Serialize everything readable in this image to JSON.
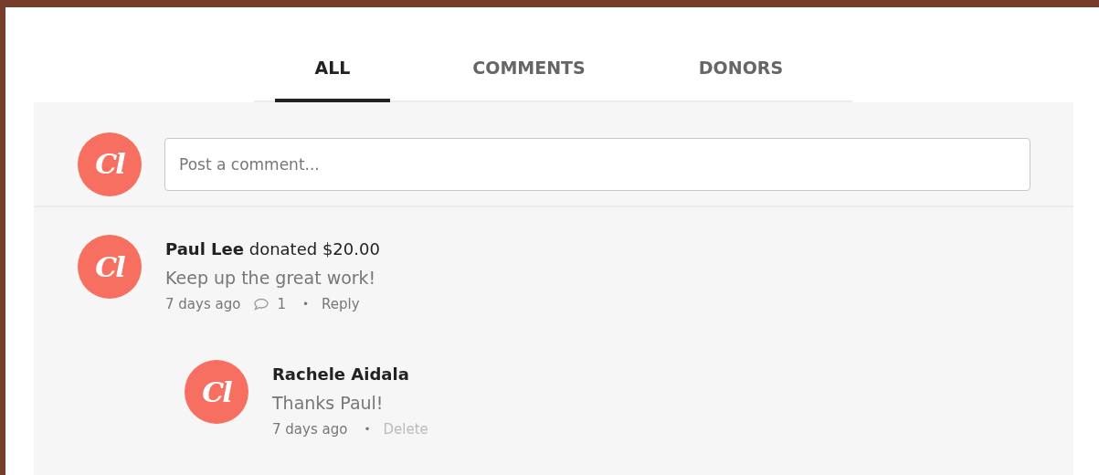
{
  "tabs": [
    {
      "label": "ALL",
      "selected": true
    },
    {
      "label": "COMMENTS",
      "selected": false
    },
    {
      "label": "DONORS",
      "selected": false
    }
  ],
  "composer": {
    "avatar": "Cl",
    "placeholder": "Post a comment..."
  },
  "comments": [
    {
      "avatar": "Cl",
      "author": "Paul Lee",
      "action": "donated $20.00",
      "body": "Keep up the great work!",
      "time": "7 days ago",
      "reply_count": "1",
      "separator": "•",
      "link": {
        "label": "Reply",
        "kind": "reply"
      },
      "replies": [
        {
          "avatar": "Cl",
          "author": "Rachele Aidala",
          "body": "Thanks Paul!",
          "time": "7 days ago",
          "separator": "•",
          "link": {
            "label": "Delete",
            "kind": "delete"
          }
        }
      ]
    }
  ]
}
